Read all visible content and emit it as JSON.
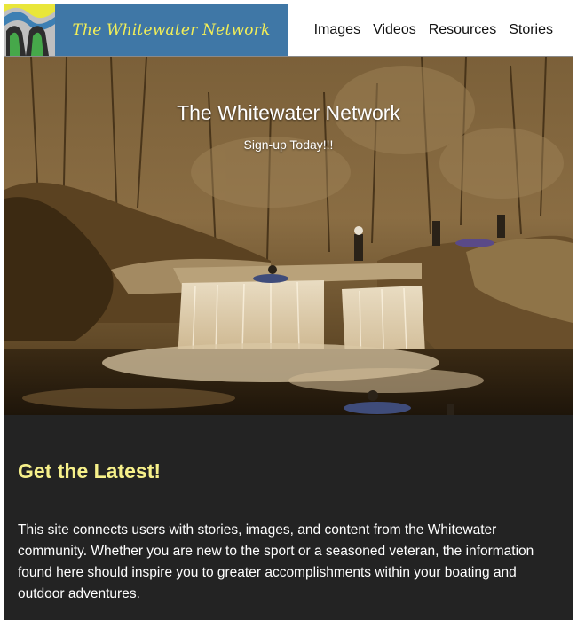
{
  "header": {
    "logo_text": "The Whitewater Network",
    "nav": [
      "Images",
      "Videos",
      "Resources",
      "Stories"
    ]
  },
  "hero": {
    "title": "The Whitewater Network",
    "subtitle": "Sign-up Today!!!"
  },
  "main": {
    "heading": "Get the Latest!",
    "paragraph": "This site connects users with stories, images, and content from the Whitewater community. Whether you are new to the sport or a seasoned veteran, the information found here should inspire you to greater accomplishments within your boating and outdoor adventures."
  },
  "colors": {
    "logo_banner": "#3f77a6",
    "logo_text": "#f2ee58",
    "heading": "#f6f08a",
    "content_bg": "#232323"
  },
  "icons": {
    "logo_mark": "wave-logo-icon"
  }
}
